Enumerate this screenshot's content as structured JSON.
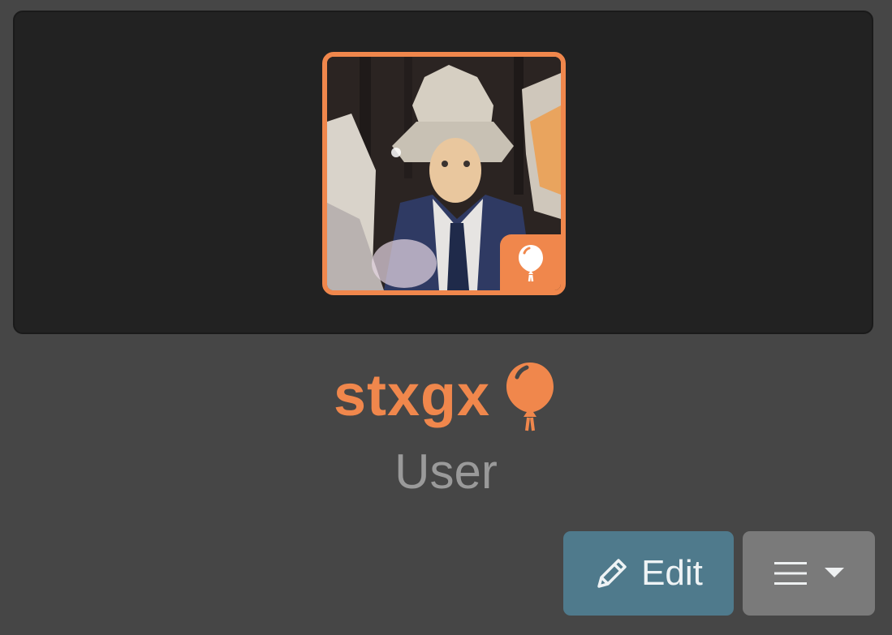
{
  "profile": {
    "username": "stxgx",
    "role": "User",
    "accent_color": "#f0874c",
    "badge_icon": "balloon-icon"
  },
  "actions": {
    "edit_label": "Edit",
    "edit_icon": "pencil-icon",
    "menu_icon": "hamburger-icon",
    "menu_caret_icon": "caret-down-icon",
    "edit_color": "#4f7a8c",
    "menu_color": "#7a7a7a"
  }
}
